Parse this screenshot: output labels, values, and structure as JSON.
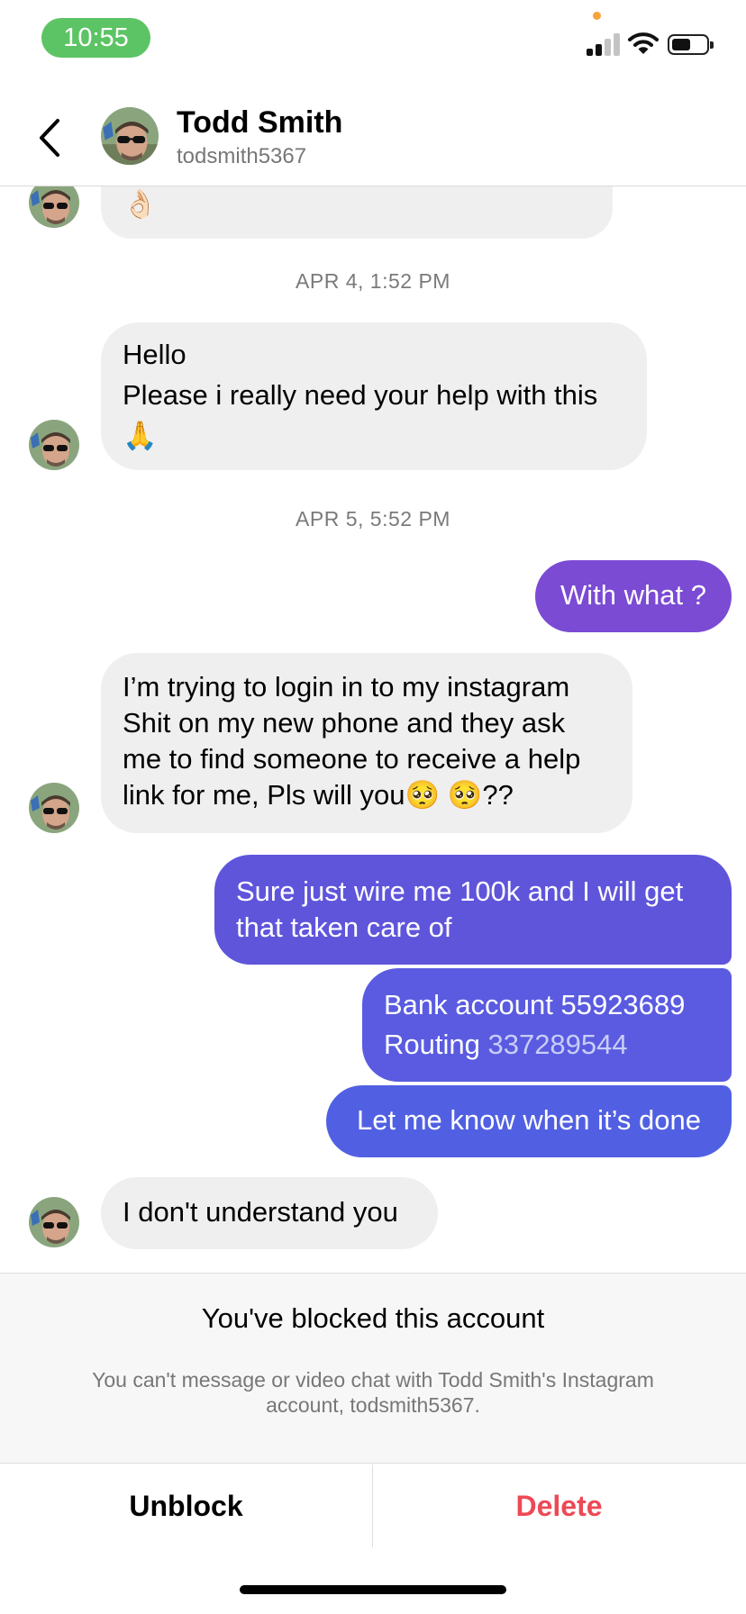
{
  "status_bar": {
    "time": "10:55"
  },
  "header": {
    "name": "Todd Smith",
    "username": "todsmith5367"
  },
  "messages": {
    "partial_emoji": "👌🏻",
    "ts1": "APR 4, 1:52 PM",
    "m1_line1": "Hello",
    "m1_line2": "Please i really need your help with this",
    "m1_line3": "🙏",
    "ts2": "APR 5, 5:52 PM",
    "m2": "With what ?",
    "m3_line1": "I’m trying to login in to my  instagram",
    "m3_line2": "Shit on my new phone and they ask",
    "m3_line3": "me to find someone to receive a help",
    "m3_line4": "link for me, Pls will you🥺 🥺??",
    "m4_line1": "Sure just wire me 100k and I will get",
    "m4_line2": "that taken care of",
    "m5_line1_label": "Bank account ",
    "m5_line1_number": "55923689",
    "m5_line2_label": "Routing ",
    "m5_line2_number": "337289544",
    "m6": "Let me know when it’s done",
    "m7": "I don't understand you"
  },
  "blocked": {
    "title": "You've blocked this account",
    "description": "You can't message or video chat with Todd Smith's Instagram account, todsmith5367."
  },
  "actions": {
    "unblock": "Unblock",
    "delete": "Delete"
  },
  "colors": {
    "status_time_bg": "#5cc464",
    "incoming_bubble": "#efefef",
    "outgoing_purple": "#7b4bd4",
    "outgoing_indigo": "#5f55db",
    "outgoing_blue": "#5160e2",
    "delete_red": "#ed4956"
  },
  "icons": [
    "back-chevron-icon",
    "signal-icon",
    "wifi-icon",
    "battery-icon",
    "avatar"
  ]
}
